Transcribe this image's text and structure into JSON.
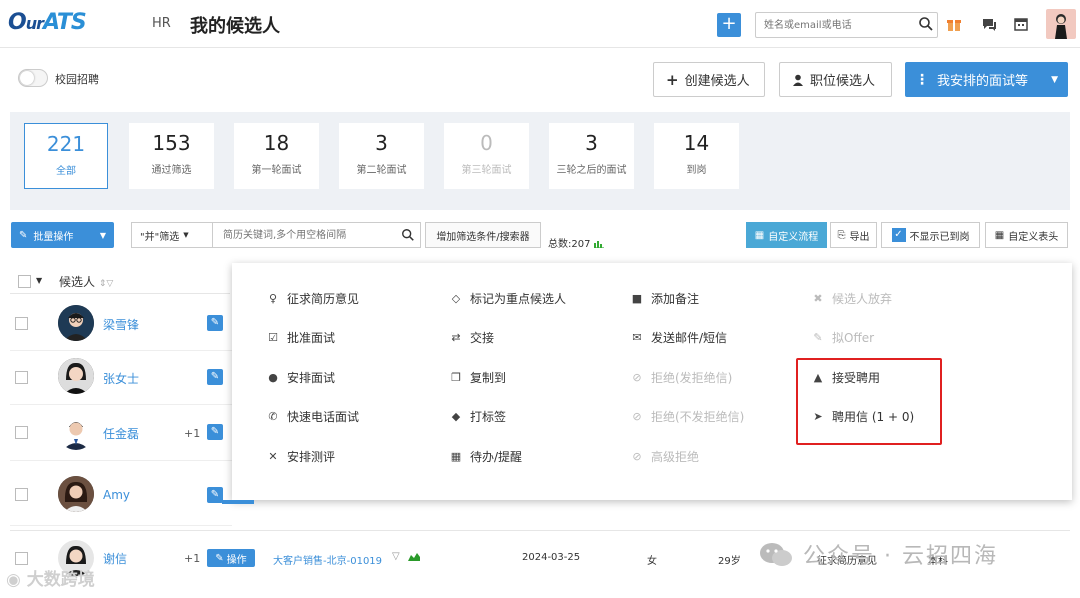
{
  "header": {
    "logo": {
      "part1": "O",
      "part2": "ur",
      "part3": "ATS"
    },
    "hr_label": "HR",
    "title": "我的候选人",
    "add_label": "+",
    "search_placeholder": "姓名或email或电话"
  },
  "toolbar": {
    "campus_toggle_label": "校园招聘",
    "create_candidate": "创建候选人",
    "position_candidate": "职位候选人",
    "my_interviews": "我安排的面试等"
  },
  "stats": [
    {
      "num": "221",
      "label": "全部",
      "state": "active"
    },
    {
      "num": "153",
      "label": "通过筛选",
      "state": "normal"
    },
    {
      "num": "18",
      "label": "第一轮面试",
      "state": "normal"
    },
    {
      "num": "3",
      "label": "第二轮面试",
      "state": "normal"
    },
    {
      "num": "0",
      "label": "第三轮面试",
      "state": "disabled"
    },
    {
      "num": "3",
      "label": "三轮之后的面试",
      "state": "normal"
    },
    {
      "num": "14",
      "label": "到岗",
      "state": "normal"
    }
  ],
  "filters": {
    "bulk_ops": "批量操作",
    "and_filter": "\"并\"筛选",
    "keyword_placeholder": "简历关键词,多个用空格间隔",
    "add_filter": "增加筛选条件/搜索器",
    "total": "总数:207",
    "custom_flow": "自定义流程",
    "export": "导出",
    "hide_onboarded": "不显示已到岗",
    "custom_header": "自定义表头"
  },
  "table": {
    "col_candidate": "候选人",
    "rows": [
      {
        "name": "梁雪锋",
        "extra": ""
      },
      {
        "name": "张女士",
        "extra": ""
      },
      {
        "name": "任金磊",
        "extra": "+1"
      },
      {
        "name": "Amy",
        "extra": ""
      }
    ]
  },
  "menu": {
    "col1": [
      {
        "icon": "lightbulb-icon",
        "glyph": "♀",
        "label": "征求简历意见",
        "disabled": false
      },
      {
        "icon": "checkbox-icon",
        "glyph": "☑",
        "label": "批准面试",
        "disabled": false
      },
      {
        "icon": "user-icon",
        "glyph": "●",
        "label": "安排面试",
        "disabled": false
      },
      {
        "icon": "phone-icon",
        "glyph": "✆",
        "label": "快速电话面试",
        "disabled": false
      },
      {
        "icon": "expand-icon",
        "glyph": "✕",
        "label": "安排测评",
        "disabled": false
      }
    ],
    "col2": [
      {
        "icon": "diamond-icon",
        "glyph": "◇",
        "label": "标记为重点候选人",
        "disabled": false
      },
      {
        "icon": "exchange-icon",
        "glyph": "⇄",
        "label": "交接",
        "disabled": false
      },
      {
        "icon": "copy-icon",
        "glyph": "❐",
        "label": "复制到",
        "disabled": false
      },
      {
        "icon": "tag-icon",
        "glyph": "◆",
        "label": "打标签",
        "disabled": false
      },
      {
        "icon": "calendar-icon",
        "glyph": "▦",
        "label": "待办/提醒",
        "disabled": false
      }
    ],
    "col3": [
      {
        "icon": "note-icon",
        "glyph": "■",
        "label": "添加备注",
        "disabled": false
      },
      {
        "icon": "envelope-icon",
        "glyph": "✉",
        "label": "发送邮件/短信",
        "disabled": false
      },
      {
        "icon": "ban-icon",
        "glyph": "⊘",
        "label": "拒绝(发拒绝信)",
        "disabled": true
      },
      {
        "icon": "ban-icon",
        "glyph": "⊘",
        "label": "拒绝(不发拒绝信)",
        "disabled": true
      },
      {
        "icon": "ban-icon",
        "glyph": "⊘",
        "label": "高级拒绝",
        "disabled": true
      }
    ],
    "col4": [
      {
        "icon": "user-remove-icon",
        "glyph": "✖",
        "label": "候选人放弃",
        "disabled": true
      },
      {
        "icon": "edit-icon",
        "glyph": "✎",
        "label": "拟Offer",
        "disabled": true
      },
      {
        "icon": "thumbs-up-icon",
        "glyph": "👍",
        "label": "接受聘用",
        "disabled": false
      },
      {
        "icon": "send-icon",
        "glyph": "➤",
        "label": "聘用信 (1 + 0)",
        "disabled": false
      }
    ]
  },
  "bottom": {
    "name": "谢信",
    "extra": "+1",
    "op": "操作",
    "position": "大客户销售-北京-01019",
    "date": "2024-03-25",
    "gender": "女",
    "age": "29岁",
    "status": "征求简历意见",
    "edu": "本科"
  },
  "watermarks": {
    "right": "公众号 · 云招四海",
    "left": "大数跨境"
  },
  "colors": {
    "primary": "#3b8fd9",
    "highlight": "#e02020"
  }
}
